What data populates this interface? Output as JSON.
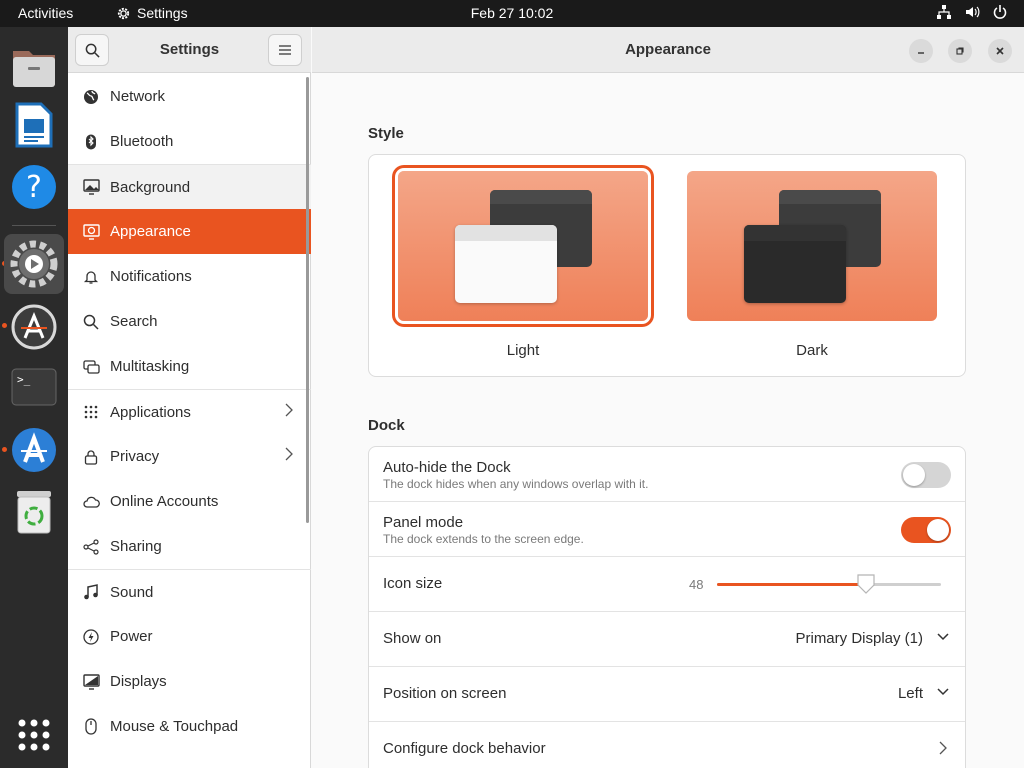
{
  "topbar": {
    "activities": "Activities",
    "app_name": "Settings",
    "clock": "Feb 27  10:02",
    "icons": [
      "network-icon",
      "volume-icon",
      "power-icon"
    ]
  },
  "dock": {
    "items": [
      {
        "name": "files-app",
        "icon": "folder-icon"
      },
      {
        "name": "libreoffice-writer",
        "icon": "document-icon"
      },
      {
        "name": "help",
        "icon": "help-icon"
      },
      {
        "name": "settings",
        "icon": "gear-icon"
      },
      {
        "name": "software-updater",
        "icon": "updater-icon"
      },
      {
        "name": "terminal",
        "icon": "terminal-icon"
      },
      {
        "name": "software-center",
        "icon": "app-store-icon"
      },
      {
        "name": "trash",
        "icon": "trash-icon"
      },
      {
        "name": "show-applications",
        "icon": "app-grid-icon"
      }
    ]
  },
  "sidebar": {
    "title": "Settings",
    "items": [
      {
        "label": "Network",
        "icon": "globe-icon"
      },
      {
        "label": "Bluetooth",
        "icon": "bluetooth-icon"
      },
      {
        "label": "Background",
        "icon": "monitor-icon"
      },
      {
        "label": "Appearance",
        "icon": "appearance-icon",
        "selected": true
      },
      {
        "label": "Notifications",
        "icon": "bell-icon"
      },
      {
        "label": "Search",
        "icon": "search-icon"
      },
      {
        "label": "Multitasking",
        "icon": "multitasking-icon"
      },
      {
        "label": "Applications",
        "icon": "grid-icon",
        "chevron": true
      },
      {
        "label": "Privacy",
        "icon": "lock-icon",
        "chevron": true
      },
      {
        "label": "Online Accounts",
        "icon": "cloud-icon"
      },
      {
        "label": "Sharing",
        "icon": "share-icon"
      },
      {
        "label": "Sound",
        "icon": "music-icon"
      },
      {
        "label": "Power",
        "icon": "power-icon"
      },
      {
        "label": "Displays",
        "icon": "display-icon"
      },
      {
        "label": "Mouse & Touchpad",
        "icon": "mouse-icon"
      }
    ]
  },
  "content": {
    "title": "Appearance",
    "style": {
      "section_title": "Style",
      "options": [
        {
          "label": "Light",
          "selected": true
        },
        {
          "label": "Dark",
          "selected": false
        }
      ]
    },
    "dock": {
      "section_title": "Dock",
      "autohide": {
        "title": "Auto-hide the Dock",
        "subtitle": "The dock hides when any windows overlap with it.",
        "on": false
      },
      "panel_mode": {
        "title": "Panel mode",
        "subtitle": "The dock extends to the screen edge.",
        "on": true
      },
      "icon_size": {
        "title": "Icon size",
        "value": "48",
        "min": 16,
        "max": 64,
        "current": 48
      },
      "show_on": {
        "title": "Show on",
        "value": "Primary Display (1)"
      },
      "position": {
        "title": "Position on screen",
        "value": "Left"
      },
      "configure": {
        "title": "Configure dock behavior"
      }
    }
  },
  "colors": {
    "accent": "#e95420",
    "sidebar_bg": "#ffffff",
    "content_bg": "#fafafa",
    "topbar_bg": "#1a1a1a",
    "dock_bg": "#2b2b2b"
  }
}
